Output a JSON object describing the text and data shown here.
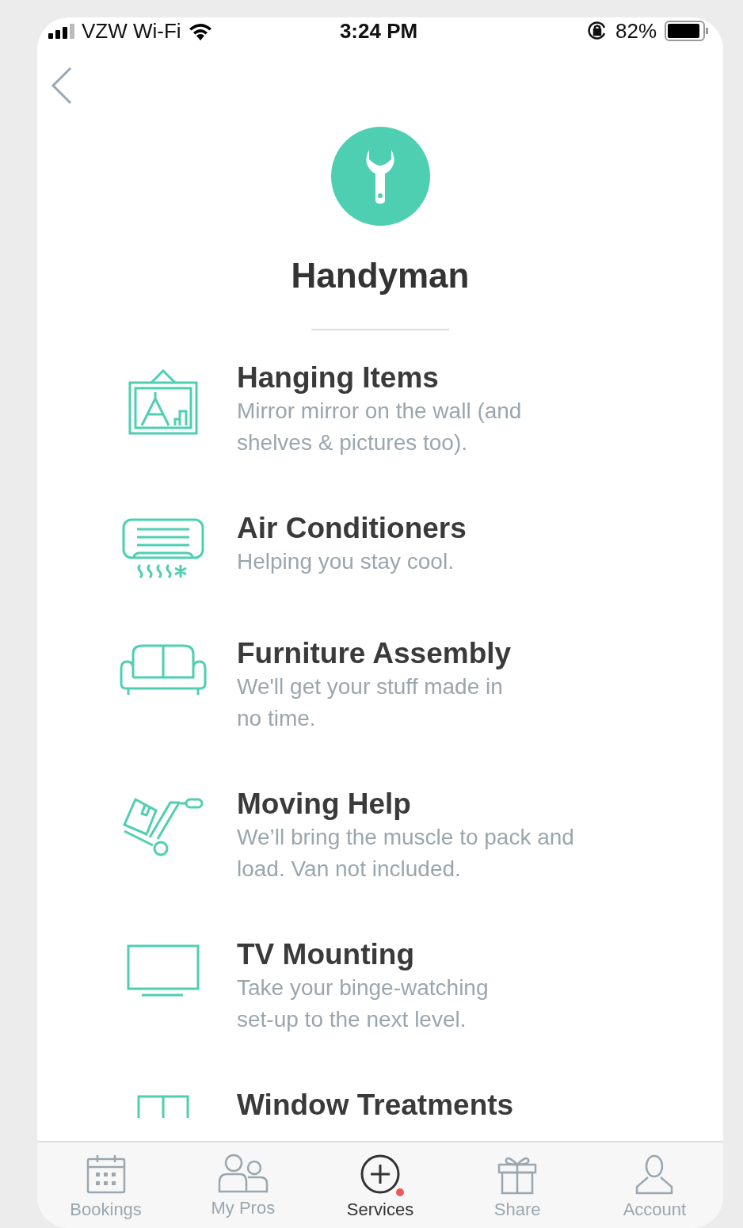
{
  "status_bar": {
    "carrier": "VZW Wi-Fi",
    "time": "3:24 PM",
    "battery": "82%"
  },
  "header": {
    "title": "Handyman"
  },
  "services": [
    {
      "kind": "picture-frame",
      "title": "Hanging Items",
      "lines": [
        "Mirror mirror on the wall (and",
        "shelves & pictures too)."
      ]
    },
    {
      "kind": "air-conditioner",
      "title": "Air Conditioners",
      "lines": [
        "Helping you stay cool."
      ]
    },
    {
      "kind": "sofa",
      "title": "Furniture Assembly",
      "lines": [
        "We'll get your stuff made in",
        "no time."
      ]
    },
    {
      "kind": "hand-truck",
      "title": "Moving Help",
      "lines": [
        "We’ll bring the muscle to pack and",
        "load. Van not included."
      ]
    },
    {
      "kind": "tv",
      "title": "TV Mounting",
      "lines": [
        "Take your binge-watching",
        "set-up to the next level."
      ]
    },
    {
      "kind": "window",
      "title": "Window Treatments"
    }
  ],
  "tab_bar": [
    {
      "kind": "calendar",
      "label": "Bookings",
      "selected": false,
      "badge": false
    },
    {
      "kind": "people",
      "label": "My Pros",
      "selected": false,
      "badge": false
    },
    {
      "kind": "plus",
      "label": "Services",
      "selected": true,
      "badge": true
    },
    {
      "kind": "gift",
      "label": "Share",
      "selected": false,
      "badge": false
    },
    {
      "kind": "person",
      "label": "Account",
      "selected": false,
      "badge": false
    }
  ]
}
